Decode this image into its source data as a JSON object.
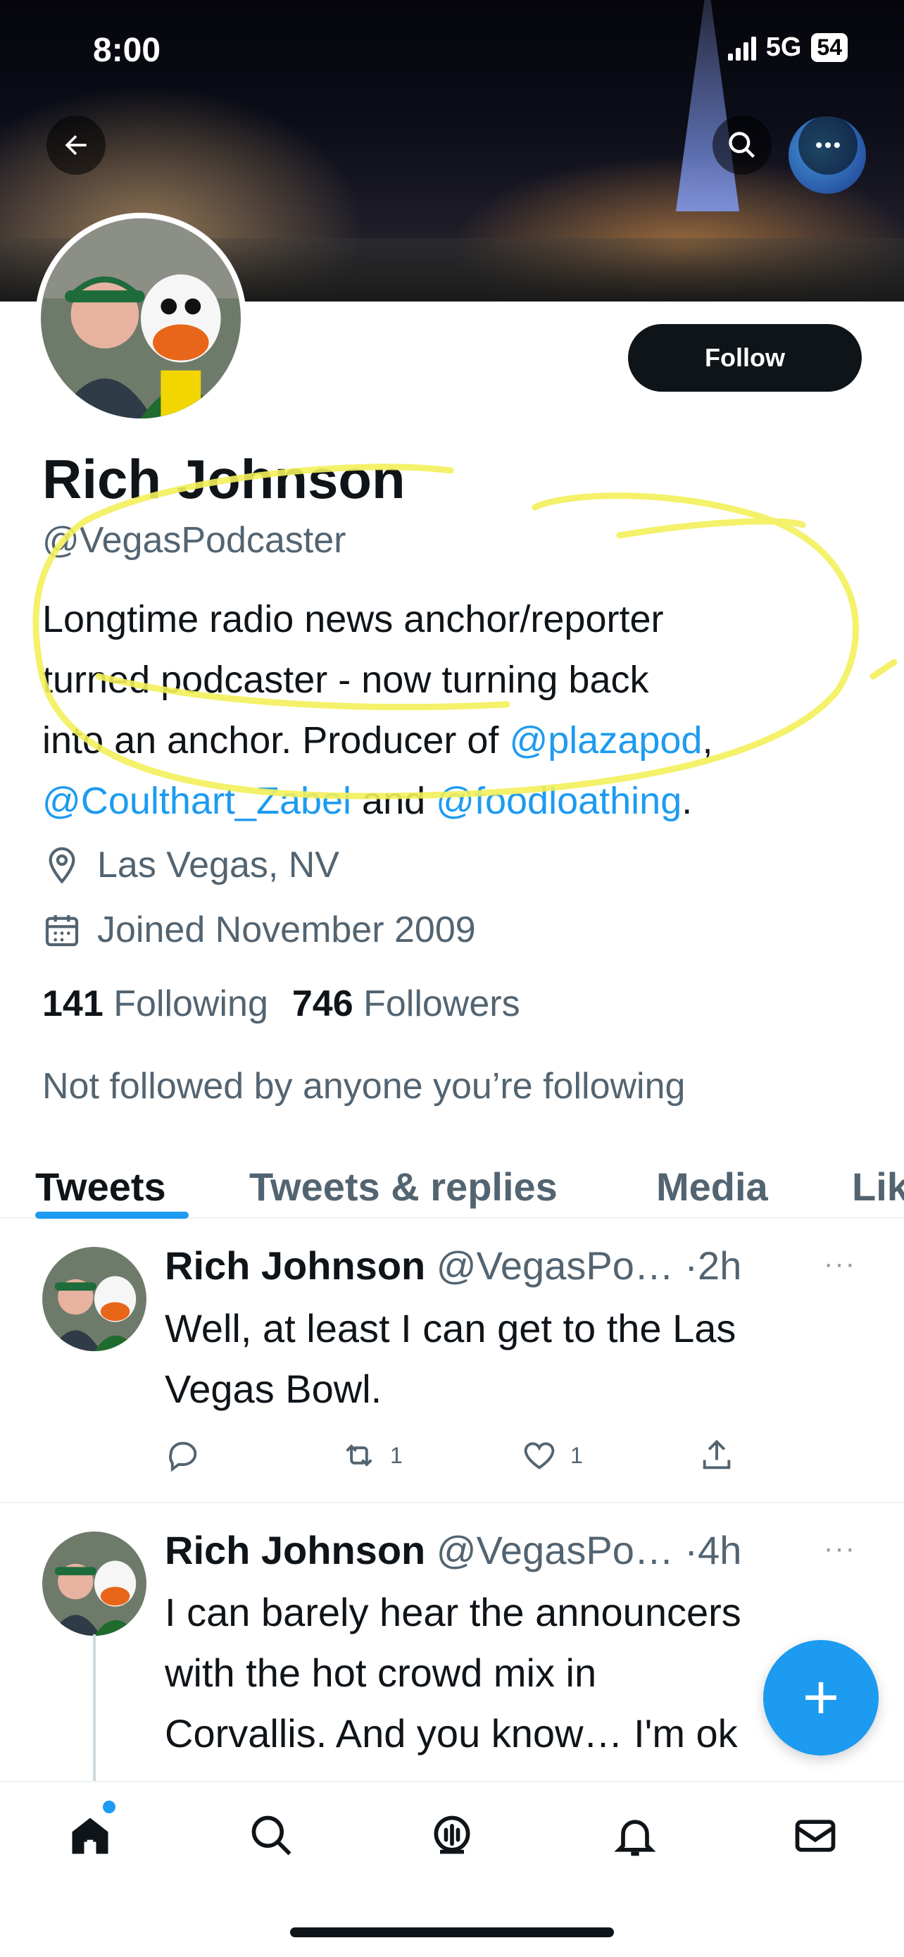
{
  "status_bar": {
    "time": "8:00",
    "network": "5G",
    "battery": "54"
  },
  "header": {
    "back_icon": "arrow-left-icon",
    "search_icon": "search-icon",
    "more_icon": "more-icon"
  },
  "profile": {
    "name": "Rich Johnson",
    "handle": "@VegasPodcaster",
    "follow_label": "Follow",
    "bio": {
      "line1": "Longtime radio news anchor/reporter",
      "line2": "turned podcaster - now turning back",
      "line3_prefix": "into an anchor. Producer of ",
      "link1": "@plazapod",
      "sep1": ",",
      "link2": "@Coulthart_Zabel",
      "and": " and ",
      "link3": "@foodloathing",
      "end": "."
    },
    "location": "Las Vegas, NV",
    "joined": "Joined November 2009",
    "following_count": "141",
    "following_label": "Following",
    "followers_count": "746",
    "followers_label": "Followers",
    "not_followed": "Not followed by anyone you’re following"
  },
  "tabs": [
    {
      "label": "Tweets"
    },
    {
      "label": "Tweets & replies"
    },
    {
      "label": "Media"
    },
    {
      "label": "Likes"
    }
  ],
  "tweets": [
    {
      "name": "Rich Johnson",
      "handle": "@VegasPo…",
      "time": "·2h",
      "more": "···",
      "text_line1": "Well, at least I can get to the Las",
      "text_line2": "Vegas Bowl.",
      "retweets": "1",
      "likes": "1"
    },
    {
      "name": "Rich Johnson",
      "handle": "@VegasPo…",
      "time": "·4h",
      "more": "···",
      "text_line1": "I can barely hear the announcers",
      "text_line2": "with the hot crowd mix in",
      "text_line3": "Corvallis. And you know… I'm ok"
    }
  ],
  "fab": {
    "label": "+"
  },
  "bottom_nav": [
    "home-icon",
    "search-icon",
    "spaces-icon",
    "bell-icon",
    "mail-icon"
  ],
  "colors": {
    "accent": "#1d9bf0",
    "text": "#0f1419",
    "secondary": "#536471",
    "highlight": "#f3ef5a"
  }
}
